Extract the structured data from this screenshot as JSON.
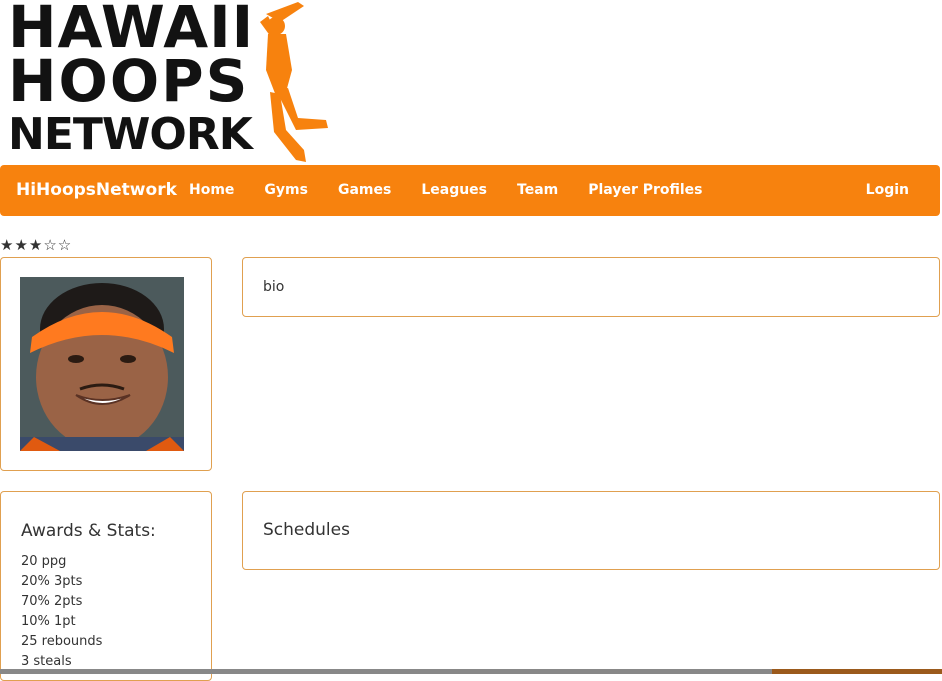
{
  "logo": {
    "line1": "HAWAII",
    "line2": "HOOPS",
    "line3": "NETWORK",
    "text_color": "#121212",
    "silhouette_color": "#f7820e"
  },
  "navbar": {
    "brand": "HiHoopsNetwork",
    "links": [
      "Home",
      "Gyms",
      "Games",
      "Leagues",
      "Team",
      "Player Profiles"
    ],
    "login": "Login",
    "background": "#f7820e"
  },
  "rating": {
    "display": "★★★☆☆",
    "value": 3,
    "max": 5
  },
  "bio": {
    "text": "bio"
  },
  "awards": {
    "heading": "Awards & Stats:",
    "items": [
      "20 ppg",
      "20% 3pts",
      "70% 2pts",
      "10% 1pt",
      "25 rebounds",
      "3 steals"
    ]
  },
  "schedules": {
    "heading": "Schedules"
  },
  "colors": {
    "panel_border": "#e0a050",
    "accent": "#f7820e"
  }
}
